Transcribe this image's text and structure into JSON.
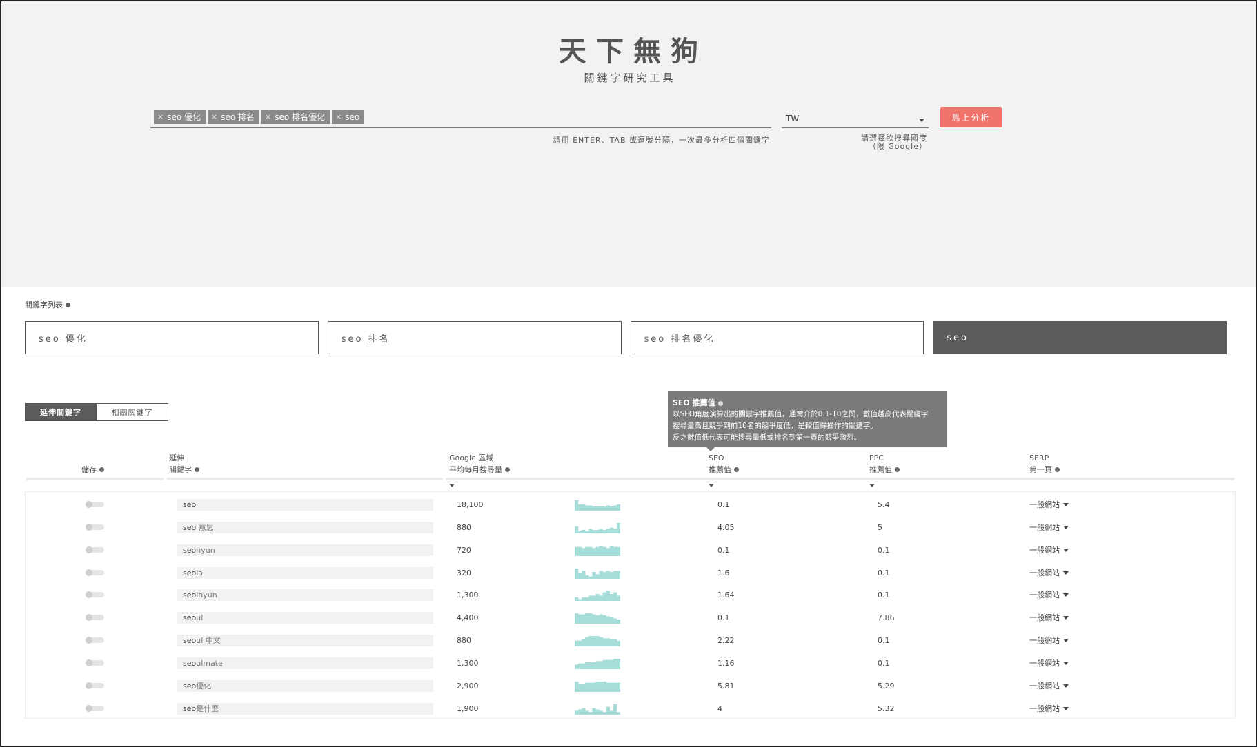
{
  "brand": {
    "title": "天下無狗",
    "subtitle": "關鍵字研究工具"
  },
  "search": {
    "tags": [
      "seo 優化",
      "seo 排名",
      "seo 排名優化",
      "seo"
    ],
    "tag_remove_glyph": "×",
    "hint": "請用 ENTER、TAB 或逗號分隔，一次最多分析四個關鍵字",
    "country_value": "TW",
    "country_hint_line1": "請選擇欲搜尋國度",
    "country_hint_line2": "（限 Google）",
    "analyze_label": "馬上分析"
  },
  "keyword_list": {
    "label": "關鍵字列表",
    "items": [
      "seo 優化",
      "seo 排名",
      "seo 排名優化",
      "seo"
    ],
    "active_index": 3
  },
  "tabs": {
    "extended": "延伸關鍵字",
    "related": "相關關鍵字",
    "active": "extended"
  },
  "tooltip": {
    "title": "SEO 推薦值",
    "line1": "以SEO角度演算出的關鍵字推薦值，通常介於0.1-10之間，數值越高代表關鍵字",
    "line2": "搜尋量高且競爭到前10名的競爭度低，是較值得操作的關鍵字。",
    "line3": "反之數值低代表可能搜尋量低或排名到第一頁的競爭激烈。"
  },
  "table": {
    "headers": {
      "save": "儲存",
      "keyword_line1": "延伸",
      "keyword_line2": "關鍵字",
      "volume_line1": "Google 區域",
      "volume_line2": "平均每月搜尋量",
      "seo_line1": "SEO",
      "seo_line2": "推薦值",
      "ppc_line1": "PPC",
      "ppc_line2": "推薦值",
      "serp_line1": "SERP",
      "serp_line2": "第一頁"
    },
    "rows": [
      {
        "kw_base": "seo",
        "kw_rest": "",
        "volume": "18,100",
        "seo": "0.1",
        "ppc": "5.4",
        "serp": "一般網站",
        "trend": [
          10,
          6,
          6,
          5,
          5,
          4,
          4,
          4,
          4,
          5,
          4,
          5,
          6
        ]
      },
      {
        "kw_base": "seo",
        "kw_rest": " 意思",
        "volume": "880",
        "seo": "4.05",
        "ppc": "5",
        "serp": "一般網站",
        "trend": [
          6,
          2,
          3,
          2,
          4,
          3,
          3,
          4,
          3,
          4,
          5,
          4,
          9
        ]
      },
      {
        "kw_base": "seo",
        "kw_rest": "hyun",
        "volume": "720",
        "seo": "0.1",
        "ppc": "0.1",
        "serp": "一般網站",
        "trend": [
          8,
          8,
          7,
          8,
          8,
          7,
          8,
          9,
          8,
          7,
          9,
          8,
          8
        ]
      },
      {
        "kw_base": "seo",
        "kw_rest": "la",
        "volume": "320",
        "seo": "1.6",
        "ppc": "0.1",
        "serp": "一般網站",
        "trend": [
          9,
          5,
          7,
          3,
          2,
          6,
          4,
          7,
          6,
          7,
          6,
          7,
          7
        ]
      },
      {
        "kw_base": "seo",
        "kw_rest": "lhyun",
        "volume": "1,300",
        "seo": "1.64",
        "ppc": "0.1",
        "serp": "一般網站",
        "trend": [
          2,
          1,
          2,
          2,
          3,
          3,
          4,
          3,
          5,
          6,
          4,
          5,
          3
        ]
      },
      {
        "kw_base": "seo",
        "kw_rest": "ul",
        "volume": "4,400",
        "seo": "0.1",
        "ppc": "7.86",
        "serp": "一般網站",
        "trend": [
          10,
          9,
          9,
          10,
          10,
          9,
          8,
          9,
          8,
          7,
          6,
          5,
          4
        ]
      },
      {
        "kw_base": "seo",
        "kw_rest": "ul 中文",
        "volume": "880",
        "seo": "2.22",
        "ppc": "0.1",
        "serp": "一般網站",
        "trend": [
          5,
          5,
          6,
          8,
          9,
          9,
          9,
          8,
          7,
          7,
          6,
          6,
          5
        ]
      },
      {
        "kw_base": "seo",
        "kw_rest": "ulmate",
        "volume": "1,300",
        "seo": "1.16",
        "ppc": "0.1",
        "serp": "一般網站",
        "trend": [
          4,
          5,
          5,
          6,
          6,
          6,
          7,
          7,
          8,
          8,
          8,
          9,
          9
        ]
      },
      {
        "kw_base": "seo",
        "kw_rest": "優化",
        "volume": "2,900",
        "seo": "5.81",
        "ppc": "5.29",
        "serp": "一般網站",
        "trend": [
          9,
          7,
          7,
          8,
          8,
          8,
          9,
          9,
          9,
          8,
          8,
          8,
          8
        ]
      },
      {
        "kw_base": "seo",
        "kw_rest": "是什麼",
        "volume": "1,900",
        "seo": "4",
        "ppc": "5.32",
        "serp": "一般網站",
        "trend": [
          3,
          4,
          5,
          3,
          2,
          5,
          4,
          3,
          2,
          6,
          3,
          8,
          2
        ]
      }
    ]
  },
  "colors": {
    "accent": "#f0736c",
    "spark": "#a6ddd9",
    "dark": "#5b5b5b"
  }
}
